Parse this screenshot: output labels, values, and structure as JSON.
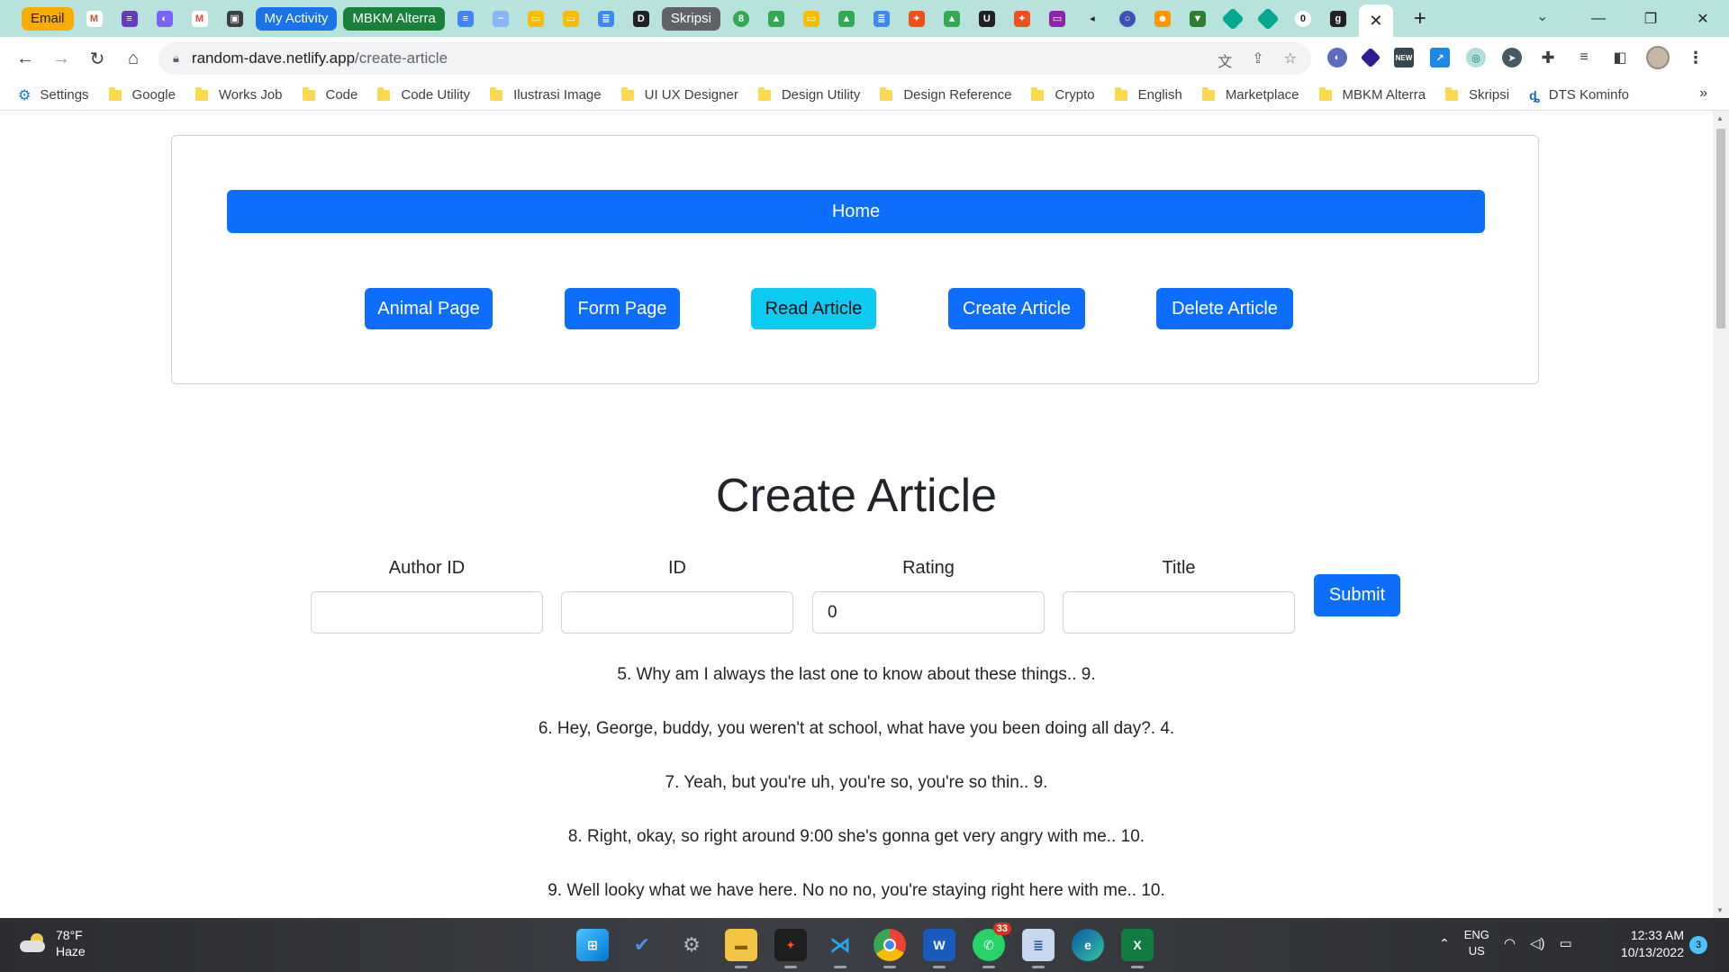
{
  "browser": {
    "tab_groups": {
      "email": "Email",
      "my_activity": "My Activity",
      "mbkm": "MBKM Alterra",
      "skripsi": "Skripsi"
    },
    "active_tab_close": "✕",
    "new_tab": "+",
    "url_host": "random-dave.netlify.app",
    "url_path": "/create-article",
    "window_controls": {
      "minimize": "—",
      "maximize": "❐",
      "close": "✕"
    }
  },
  "bookmarks": [
    {
      "label": "Settings",
      "icon": "gear-icon"
    },
    {
      "label": "Google",
      "icon": "folder-icon"
    },
    {
      "label": "Works Job",
      "icon": "folder-icon"
    },
    {
      "label": "Code",
      "icon": "folder-icon"
    },
    {
      "label": "Code Utility",
      "icon": "folder-icon"
    },
    {
      "label": "Ilustrasi Image",
      "icon": "folder-icon"
    },
    {
      "label": "UI UX Designer",
      "icon": "folder-icon"
    },
    {
      "label": "Design Utility",
      "icon": "folder-icon"
    },
    {
      "label": "Design Reference",
      "icon": "folder-icon"
    },
    {
      "label": "Crypto",
      "icon": "folder-icon"
    },
    {
      "label": "English",
      "icon": "folder-icon"
    },
    {
      "label": "Marketplace",
      "icon": "folder-icon"
    },
    {
      "label": "MBKM Alterra",
      "icon": "folder-icon"
    },
    {
      "label": "Skripsi",
      "icon": "folder-icon"
    },
    {
      "label": "DTS Kominfo",
      "icon": "dts-icon"
    }
  ],
  "nav": {
    "home": "Home",
    "animal_page": "Animal Page",
    "form_page": "Form Page",
    "read_article": "Read Article",
    "create_article": "Create Article",
    "delete_article": "Delete Article"
  },
  "page": {
    "title": "Create Article"
  },
  "form": {
    "author_id_label": "Author ID",
    "author_id_value": "",
    "id_label": "ID",
    "id_value": "",
    "rating_label": "Rating",
    "rating_value": "0",
    "title_label": "Title",
    "title_value": "",
    "submit": "Submit"
  },
  "articles": [
    "5. Why am I always the last one to know about these things.. 9.",
    "6. Hey, George, buddy, you weren't at school, what have you been doing all day?. 4.",
    "7. Yeah, but you're uh, you're so, you're so thin.. 9.",
    "8. Right, okay, so right around 9:00 she's gonna get very angry with me.. 10.",
    "9. Well looky what we have here. No no no, you're staying right here with me.. 10."
  ],
  "taskbar": {
    "temperature": "78°F",
    "condition": "Haze",
    "whatsapp_badge": "33",
    "lang_top": "ENG",
    "lang_bottom": "US",
    "time": "12:33 AM",
    "date": "10/13/2022",
    "notifications": "3"
  },
  "colors": {
    "primary": "#0d6efd",
    "info": "#0dcaf0",
    "tabstrip": "#b7e3dc"
  }
}
